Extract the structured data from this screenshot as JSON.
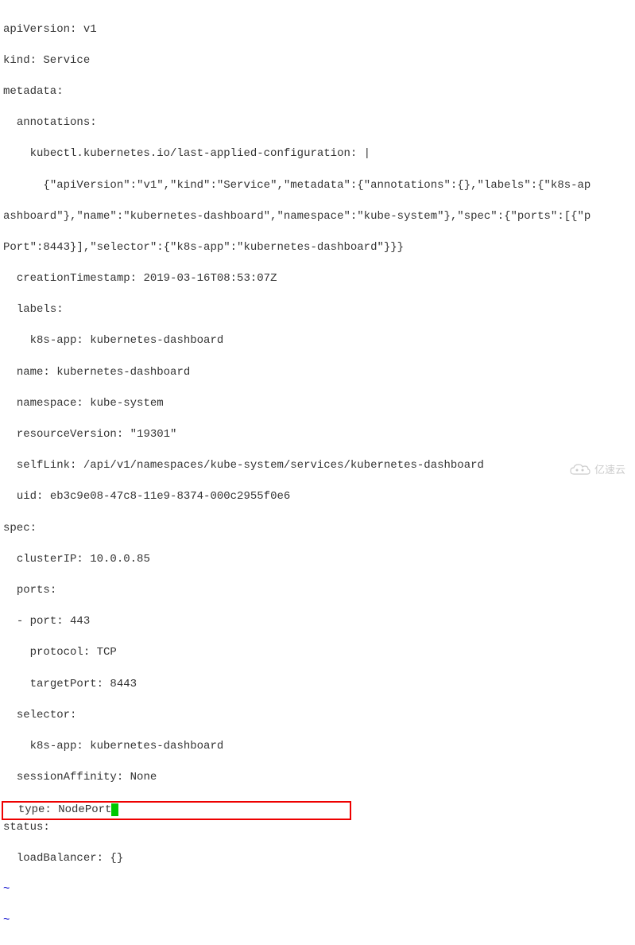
{
  "yaml": {
    "line1": "apiVersion: v1",
    "line2": "kind: Service",
    "line3": "metadata:",
    "line4": "  annotations:",
    "line5": "    kubectl.kubernetes.io/last-applied-configuration: |",
    "line6": "      {\"apiVersion\":\"v1\",\"kind\":\"Service\",\"metadata\":{\"annotations\":{},\"labels\":{\"k8s-ap",
    "line7": "ashboard\"},\"name\":\"kubernetes-dashboard\",\"namespace\":\"kube-system\"},\"spec\":{\"ports\":[{\"p",
    "line8": "Port\":8443}],\"selector\":{\"k8s-app\":\"kubernetes-dashboard\"}}}",
    "line9": "  creationTimestamp: 2019-03-16T08:53:07Z",
    "line10": "  labels:",
    "line11": "    k8s-app: kubernetes-dashboard",
    "line12": "  name: kubernetes-dashboard",
    "line13": "  namespace: kube-system",
    "line14": "  resourceVersion: \"19301\"",
    "line15": "  selfLink: /api/v1/namespaces/kube-system/services/kubernetes-dashboard",
    "line16": "  uid: eb3c9e08-47c8-11e9-8374-000c2955f0e6",
    "line17": "spec:",
    "line18": "  clusterIP: 10.0.0.85",
    "line19": "  ports:",
    "line20": "  - port: 443",
    "line21": "    protocol: TCP",
    "line22": "    targetPort: 8443",
    "line23": "  selector:",
    "line24": "    k8s-app: kubernetes-dashboard",
    "line25": "  sessionAffinity: None",
    "line26": "  type: NodePort",
    "line27": "status:",
    "line28": "  loadBalancer: {}",
    "tilde": "~",
    "tilde2": "~"
  },
  "watermark": {
    "text": "亿速云"
  }
}
